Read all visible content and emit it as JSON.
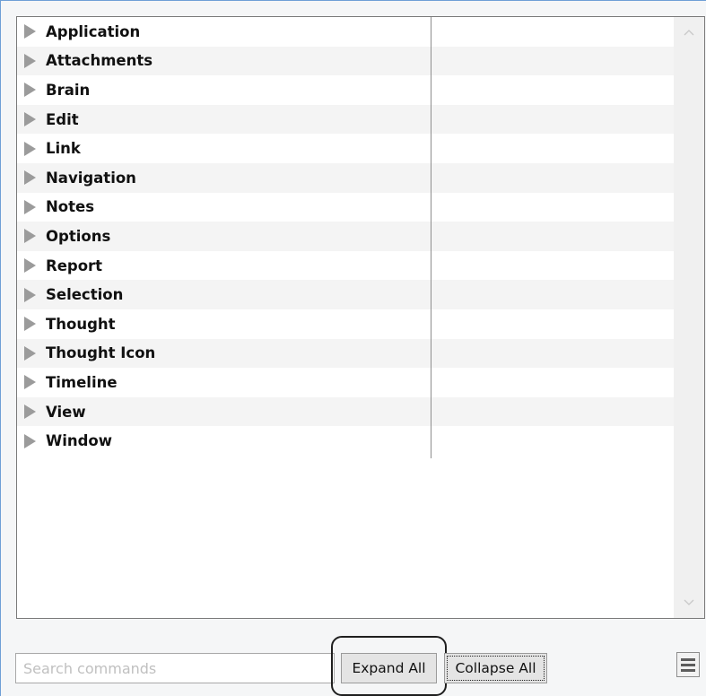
{
  "tree": {
    "items": [
      {
        "label": "Application"
      },
      {
        "label": "Attachments"
      },
      {
        "label": "Brain"
      },
      {
        "label": "Edit"
      },
      {
        "label": "Link"
      },
      {
        "label": "Navigation"
      },
      {
        "label": "Notes"
      },
      {
        "label": "Options"
      },
      {
        "label": "Report"
      },
      {
        "label": "Selection"
      },
      {
        "label": "Thought"
      },
      {
        "label": "Thought Icon"
      },
      {
        "label": "Timeline"
      },
      {
        "label": "View"
      },
      {
        "label": "Window"
      }
    ],
    "expander_icon": "triangle-right-icon"
  },
  "scrollbar": {
    "up_icon": "chevron-up-icon",
    "down_icon": "chevron-down-icon"
  },
  "footer": {
    "search_placeholder": "Search commands",
    "search_value": "",
    "expand_all_label": "Expand All",
    "collapse_all_label": "Collapse All",
    "menu_icon": "hamburger-menu-icon"
  },
  "colors": {
    "window_border": "#6f9fd6",
    "row_alt": "#f4f4f4",
    "expander": "#9b9b9b"
  }
}
